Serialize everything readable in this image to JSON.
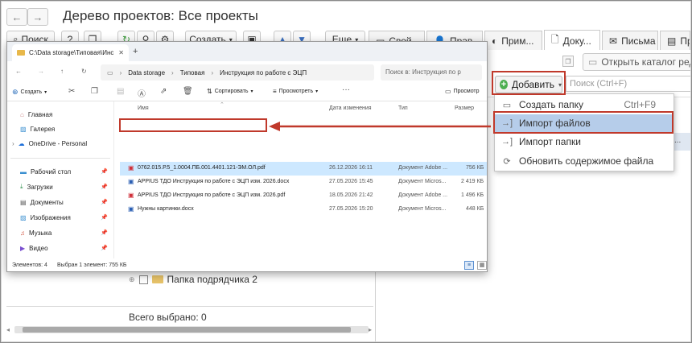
{
  "app": {
    "title": "Дерево проектов: Все проекты",
    "toolbar": {
      "search": "Поиск",
      "help": "?",
      "create": "Создать",
      "more": "Еще"
    },
    "tabs": [
      "Свой",
      "Прав",
      "Прим...",
      "Доку...",
      "Письма",
      "Про"
    ],
    "right": {
      "open_catalog": "Открыть каталог редакт",
      "add_button": "Добавить",
      "search_placeholder": "Поиск (Ctrl+F)"
    },
    "tree": {
      "folder": "Папка подрядчика 2",
      "selected_total": "Всего выбрано: 0"
    },
    "menu": {
      "items": [
        {
          "label": "Создать папку",
          "shortcut": "Ctrl+F9"
        },
        {
          "label": "Импорт файлов",
          "shortcut": ""
        },
        {
          "label": "Импорт папки",
          "shortcut": ""
        },
        {
          "label": "Обновить содержимое файла",
          "shortcut": ""
        }
      ]
    }
  },
  "explorer": {
    "tab_title": "C:\\Data storage\\Типовая\\Инс",
    "breadcrumb": [
      "Data storage",
      "Типовая",
      "Инструкция по работе с ЭЦП"
    ],
    "search_placeholder": "Поиск в: Инструкция по р",
    "commands": {
      "create": "Создать",
      "sort": "Сортировать",
      "view": "Просмотреть",
      "preview": "Просмотр"
    },
    "columns": [
      "Имя",
      "Дата изменения",
      "Тип",
      "Размер"
    ],
    "files": [
      {
        "name": "0762.015.Р.5_1.0004.ПБ.001.4401.121-ЭМ.ОЛ.pdf",
        "date": "26.12.2026 16:11",
        "type": "Документ Adobe ...",
        "size": "756 КБ",
        "kind": "pdf"
      },
      {
        "name": "APPIUS ТДО Инструкция по работе с ЭЦП изм. 2026.docx",
        "date": "27.05.2026 15:45",
        "type": "Документ Micros...",
        "size": "2 419 КБ",
        "kind": "doc"
      },
      {
        "name": "APPIUS ТДО Инструкция по работе с ЭЦП изм. 2026.pdf",
        "date": "18.05.2026 21:42",
        "type": "Документ Adobe ...",
        "size": "1 496 КБ",
        "kind": "pdf"
      },
      {
        "name": "Нужны картинки.docx",
        "date": "27.05.2026 15:20",
        "type": "Документ Micros...",
        "size": "448 КБ",
        "kind": "doc"
      }
    ],
    "sidebar": {
      "home": "Главная",
      "gallery": "Галерея",
      "onedrive": "OneDrive - Personal",
      "desktop": "Рабочий стол",
      "downloads": "Загрузки",
      "documents": "Документы",
      "images": "Изображения",
      "music": "Музыка",
      "video": "Видео"
    },
    "status": {
      "count": "Элементов: 4",
      "selected": "Выбран 1 элемент: 755 КБ"
    }
  },
  "colors": {
    "highlight_red": "#c0392b",
    "menu_highlight": "#b6cdea",
    "add_green": "#4caf50"
  }
}
